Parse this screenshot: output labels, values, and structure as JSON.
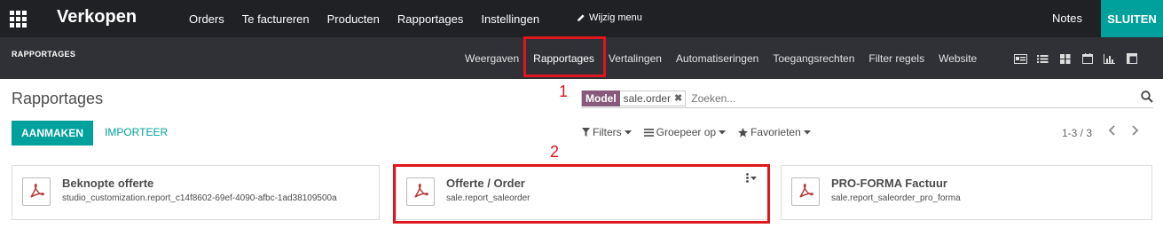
{
  "topbar": {
    "app_title": "Verkopen",
    "menu": [
      "Orders",
      "Te factureren",
      "Producten",
      "Rapportages",
      "Instellingen"
    ],
    "edit_menu": "Wijzig menu",
    "notes": "Notes",
    "close": "SLUITEN"
  },
  "studio": {
    "title": "RAPPORTAGES",
    "tabs": [
      "Weergaven",
      "Rapportages",
      "Vertalingen",
      "Automatiseringen",
      "Toegangsrechten",
      "Filter regels",
      "Website"
    ],
    "active_tab": "Rapportages",
    "view_icons": [
      "form-view-icon",
      "list-view-icon",
      "kanban-view-icon",
      "calendar-view-icon",
      "graph-view-icon",
      "pivot-view-icon"
    ]
  },
  "annotations": {
    "one": "1",
    "two": "2",
    "highlight_color": "#e0161e"
  },
  "control": {
    "breadcrumb": "Rapportages",
    "create": "AANMAKEN",
    "import": "IMPORTEER",
    "facet_label": "Model",
    "facet_value": "sale.order",
    "search_placeholder": "Zoeken...",
    "filters": "Filters",
    "group_by": "Groepeer op",
    "favorites": "Favorieten",
    "pager": "1-3 / 3"
  },
  "reports": [
    {
      "name": "Beknopte offerte",
      "technical": "studio_customization.report_c14f8602-69ef-4090-afbc-1ad38109500a"
    },
    {
      "name": "Offerte / Order",
      "technical": "sale.report_saleorder"
    },
    {
      "name": "PRO-FORMA Factuur",
      "technical": "sale.report_saleorder_pro_forma"
    }
  ],
  "colors": {
    "brand": "#875a7b",
    "accent": "#00a09d",
    "topbar": "#202125",
    "subbar": "#2f3136",
    "pdf": "#b73a3a"
  }
}
